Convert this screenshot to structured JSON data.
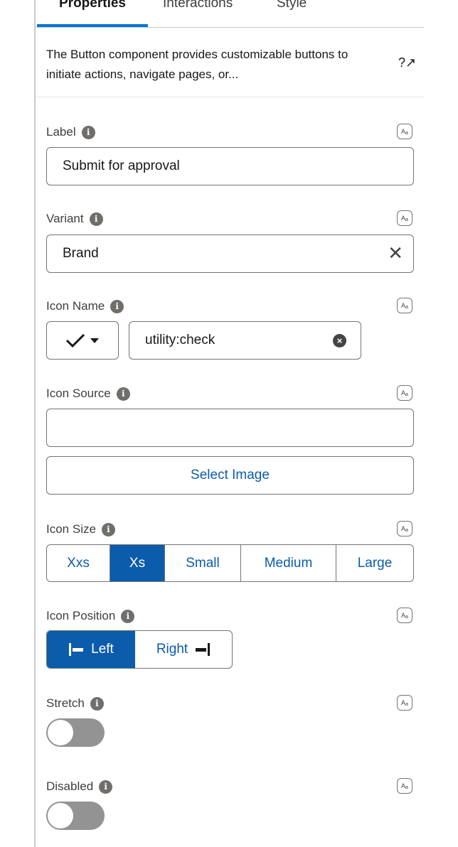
{
  "tabs": [
    "Properties",
    "Interactions",
    "Style"
  ],
  "active_tab": "Properties",
  "description": "The Button component provides customizable buttons to initiate actions, navigate pages, or...",
  "help_icon": "?↗",
  "fields": {
    "label": {
      "label": "Label",
      "value": "Submit for approval"
    },
    "variant": {
      "label": "Variant",
      "value": "Brand"
    },
    "icon_name": {
      "label": "Icon Name",
      "value": "utility:check"
    },
    "icon_source": {
      "label": "Icon Source",
      "value": "",
      "button": "Select Image"
    },
    "icon_size": {
      "label": "Icon Size",
      "options": [
        "Xxs",
        "Xs",
        "Small",
        "Medium",
        "Large"
      ],
      "selected": "Xs"
    },
    "icon_position": {
      "label": "Icon Position",
      "options": [
        "Left",
        "Right"
      ],
      "selected": "Left"
    },
    "stretch": {
      "label": "Stretch",
      "on": false
    },
    "disabled": {
      "label": "Disabled",
      "on": false
    }
  },
  "colors": {
    "brand": "#0b5cab",
    "tab_active": "#0176d3",
    "toggle_off": "#939393"
  }
}
